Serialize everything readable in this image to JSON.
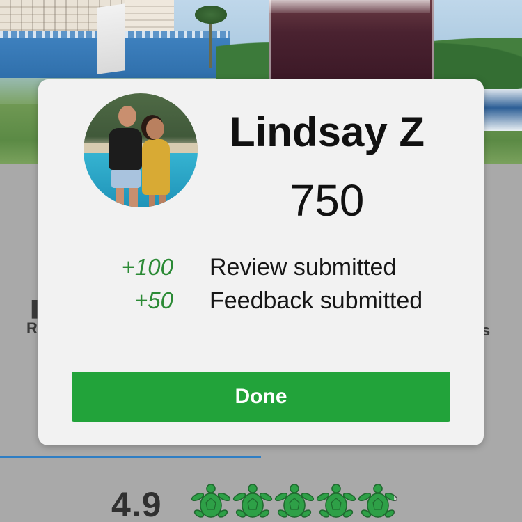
{
  "profile": {
    "name": "Lindsay Z",
    "points": "750"
  },
  "activity": [
    {
      "points": "+100",
      "label": "Review submitted"
    },
    {
      "points": "+50",
      "label": "Feedback submitted"
    }
  ],
  "actions": {
    "done_label": "Done"
  },
  "background": {
    "left_partial_text": "R",
    "right_partial_text": "s",
    "rating_value": "4.9",
    "rating_icon": "turtle-icon",
    "rating_fraction": 0.9
  },
  "colors": {
    "accent_green": "#22a33a",
    "points_green": "#2b8a35",
    "progress_blue": "#2f7ec4"
  }
}
